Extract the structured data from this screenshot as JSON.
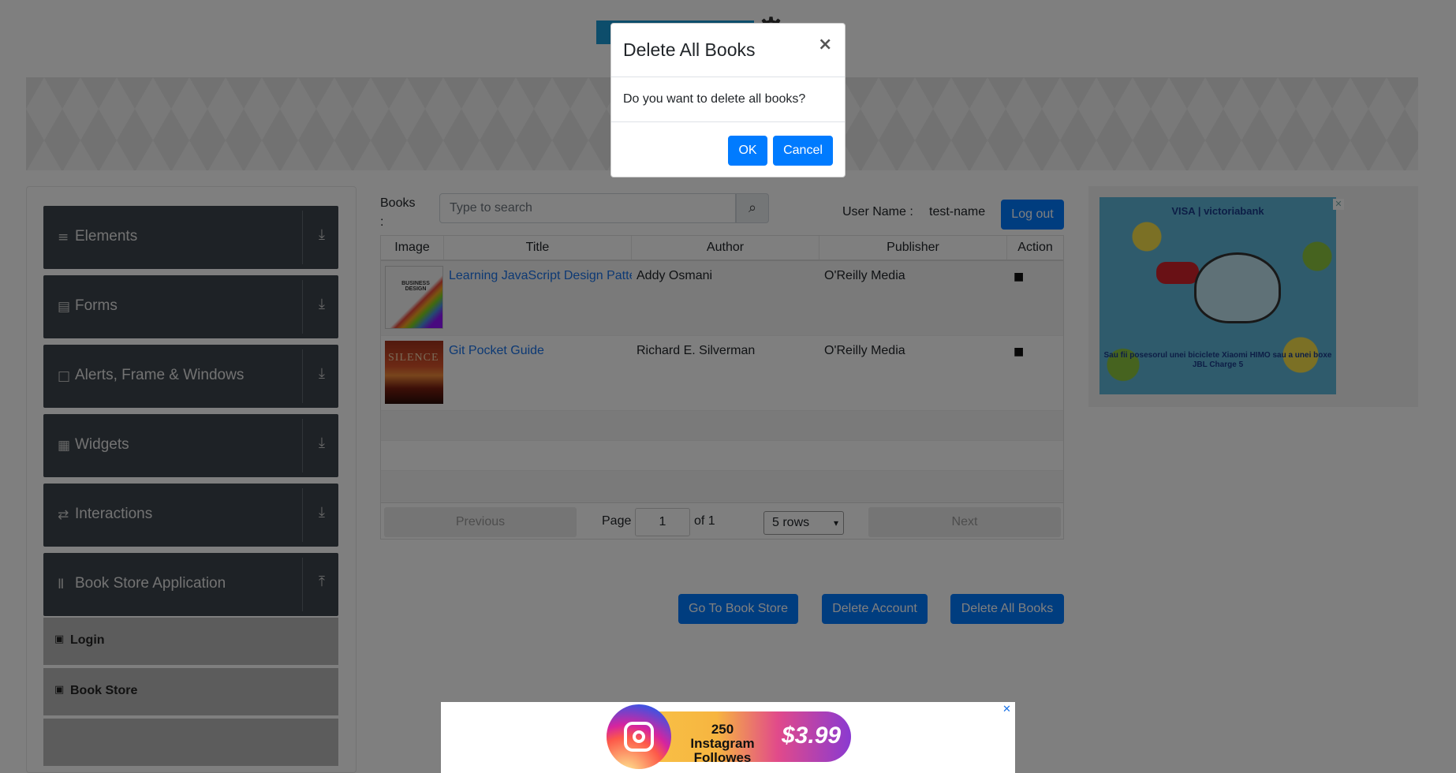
{
  "sidebar": {
    "groups": [
      {
        "label": "Elements",
        "icon": "hamburger-icon",
        "glyph": "≡",
        "arrow": "⤓"
      },
      {
        "label": "Forms",
        "icon": "document-icon",
        "glyph": "▤",
        "arrow": "⤓"
      },
      {
        "label": "Alerts, Frame & Windows",
        "icon": "window-icon",
        "glyph": "□",
        "arrow": "⤓"
      },
      {
        "label": "Widgets",
        "icon": "widgets-icon",
        "glyph": "▦",
        "arrow": "⤓"
      },
      {
        "label": "Interactions",
        "icon": "interactions-icon",
        "glyph": "⇄",
        "arrow": "⤓"
      },
      {
        "label": "Book Store Application",
        "icon": "books-icon",
        "glyph": "Ⅱ",
        "arrow": "⤒"
      }
    ],
    "subitems": [
      {
        "label": "Login",
        "glyph": "▣"
      },
      {
        "label": "Book Store",
        "glyph": "▣"
      }
    ]
  },
  "main": {
    "books_label": "Books :",
    "search_placeholder": "Type to search",
    "search_glyph": "⌕",
    "user_label": "User Name :",
    "user_value": "test-name",
    "logout_label": "Log out",
    "table": {
      "headers": [
        "Image",
        "Title",
        "Author",
        "Publisher",
        "Action"
      ],
      "rows": [
        {
          "title": "Learning JavaScript Design Patterns",
          "author": "Addy Osmani",
          "publisher": "O'Reilly Media",
          "cover_text": "BUSINESS DESIGN"
        },
        {
          "title": "Git Pocket Guide",
          "author": "Richard E. Silverman",
          "publisher": "O'Reilly Media",
          "cover_text": "SILENCE"
        }
      ],
      "delete_glyph": "■"
    },
    "pager": {
      "previous": "Previous",
      "page_label": "Page",
      "page_value": "1",
      "of_label": "of 1",
      "rows_select": "5 rows",
      "caret": "▾",
      "next": "Next"
    },
    "buttons": {
      "go_to_store": "Go To Book Store",
      "delete_account": "Delete Account",
      "delete_all": "Delete All Books"
    }
  },
  "modal": {
    "title": "Delete All Books",
    "close": "×",
    "body": "Do you want to delete all books?",
    "ok": "OK",
    "cancel": "Cancel"
  },
  "ads": {
    "right": {
      "header": "VISA | victoriabank",
      "body": "Sau fii posesorul unei biciclete Xiaomi HIMO sau a unei boxe JBL Charge 5",
      "close": "✕"
    },
    "bottom": {
      "text": "250 Instagram Followes",
      "price": "$3.99",
      "close": "✕"
    }
  },
  "colors": {
    "primary": "#007bff",
    "sidebar_dark": "#3d444c",
    "overlay": "rgba(0,0,0,0.5)"
  }
}
